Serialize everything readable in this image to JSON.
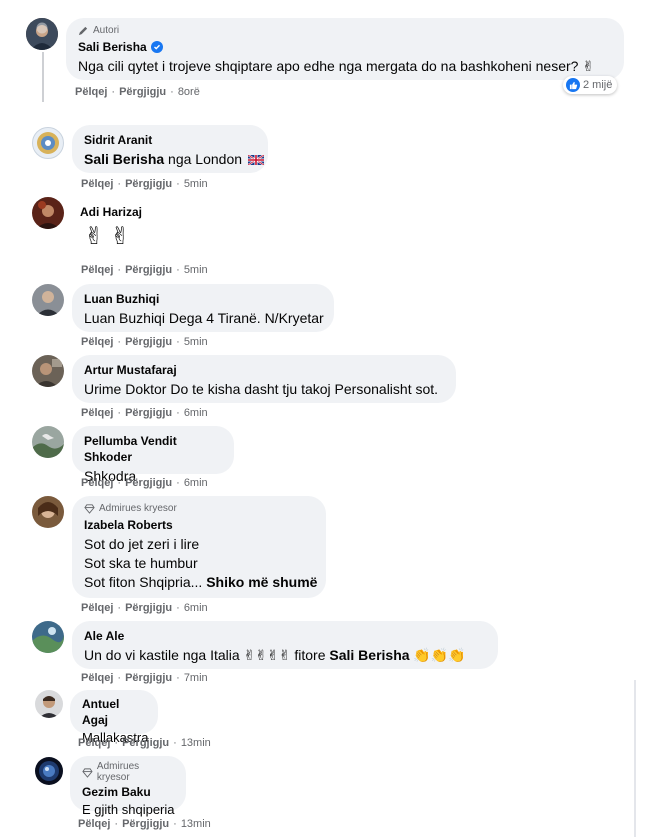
{
  "actions": {
    "like": "Pëlqej",
    "reply": "Përgjigju",
    "dot": "·"
  },
  "main_post": {
    "badge": "Autori",
    "author": "Sali Berisha",
    "text": "Nga cili qytet i trojeve shqiptare apo edhe nga mergata do na bashkoheni neser?",
    "reaction_count": "2 mijë",
    "time": "8orë"
  },
  "comments": [
    {
      "author": "Sidrit Aranit",
      "mention": "Sali Berisha",
      "text": " nga London",
      "time": "5min"
    },
    {
      "author": "Adi Harizaj",
      "time": "5min"
    },
    {
      "author": "Luan Buzhiqi",
      "text": "Luan Buzhiqi Dega 4 Tiranë. N/Kryetar",
      "time": "5min"
    },
    {
      "author": "Artur Mustafaraj",
      "text": "Urime Doktor Do te kisha dasht tju takoj Personalisht sot.",
      "time": "6min"
    },
    {
      "author": "Pellumba Vendit Shkoder",
      "text": "Shkodra",
      "time": "6min"
    },
    {
      "badge": "Admirues kryesor",
      "author": "Izabela Roberts",
      "lines": [
        "Sot do jet zeri i lire",
        "Sot ska te humbur",
        "Sot fiton Shqipria..."
      ],
      "see_more": "Shiko më shumë",
      "time": "6min"
    },
    {
      "author": "Ale Ale",
      "text_a": "Un do vi kastile nga Italia",
      "text_b": "fitore",
      "mention": "Sali Berisha",
      "time": "7min"
    },
    {
      "author": "Antuel Agaj",
      "text": "Mallakastra",
      "time": "13min"
    },
    {
      "badge": "Admirues kryesor",
      "author": "Gezim Baku",
      "text": "E gjith shqiperia",
      "time": "13min"
    }
  ],
  "colors": {
    "bubble": "#f0f2f5",
    "meta": "#65676b",
    "accent": "#1877f2",
    "text": "#050505"
  }
}
